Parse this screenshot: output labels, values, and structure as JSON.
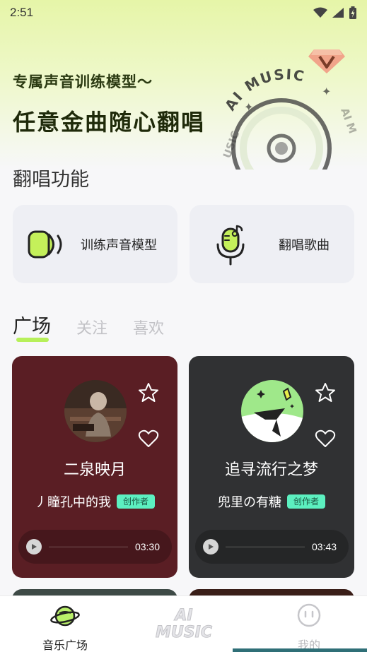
{
  "status_bar": {
    "time": "2:51"
  },
  "hero": {
    "line1": "专属声音训练模型～",
    "line2": "任意金曲随心翻唱",
    "disc_text_top": "AI MUSIC",
    "disc_text_side_left": "USIC",
    "disc_text_side_right": "AI M",
    "vip_icon": "diamond-v-icon"
  },
  "functions": {
    "title": "翻唱功能",
    "items": [
      {
        "label": "训练声音模型",
        "icon": "speaker-icon"
      },
      {
        "label": "翻唱歌曲",
        "icon": "microphone-icon"
      }
    ]
  },
  "tabs": [
    {
      "label": "广场",
      "active": true
    },
    {
      "label": "关注",
      "active": false
    },
    {
      "label": "喜欢",
      "active": false
    }
  ],
  "cards": [
    {
      "title": "二泉映月",
      "author": "丿瞳孔中的我",
      "badge": "创作者",
      "duration": "03:30",
      "bg_color": "#5a1e24"
    },
    {
      "title": "追寻流行之梦",
      "author": "兜里の有糖",
      "badge": "创作者",
      "duration": "03:43",
      "bg_color": "#303133"
    }
  ],
  "bottom_nav": {
    "items": [
      {
        "label": "音乐广场",
        "icon": "planet-icon",
        "active": true
      },
      {
        "label": "AI MUSIC",
        "icon": "ai-music-logo",
        "active": false
      },
      {
        "label": "我的",
        "icon": "smiley-face-icon",
        "active": false
      }
    ]
  },
  "colors": {
    "accent": "#b7f05a",
    "badge_bg": "#5cf0c0",
    "hero_gradient_top": "#e6f5a8"
  }
}
